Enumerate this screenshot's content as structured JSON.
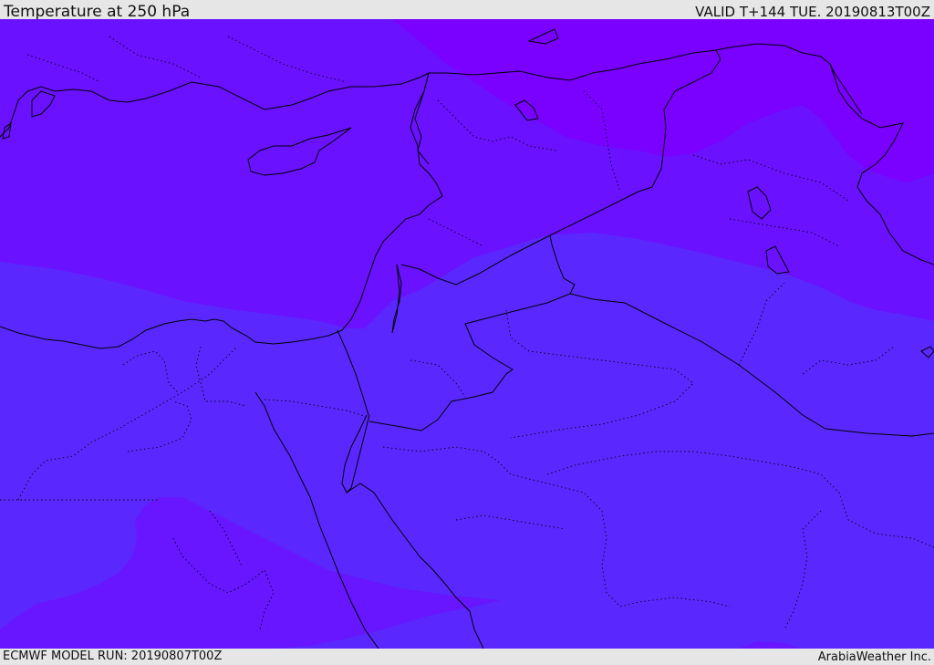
{
  "header": {
    "title": "Temperature at 250 hPa",
    "valid": "VALID T+144 TUE. 20190813T00Z"
  },
  "footer": {
    "model_run": "ECMWF MODEL RUN: 20190807T00Z",
    "brand": "ArabiaWeather Inc."
  },
  "colors": {
    "cold_band": "#6a11ff",
    "mid_band": "#5a28ff",
    "warm_band": "#7a00ff",
    "southwest_patch": "#6716ff",
    "borders": "#000000"
  }
}
